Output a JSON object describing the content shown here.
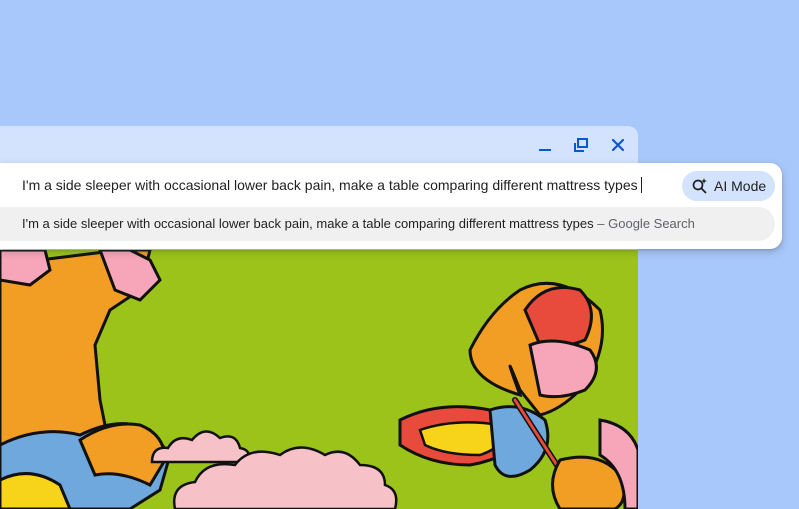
{
  "colors": {
    "background": "#a8c7fa",
    "window_frame": "#d3e3fd",
    "window_controls": "#0b57d0",
    "ai_mode_chip": "#d3e3fd",
    "suggestion_bg": "#f0f0f0",
    "art_green": "#9bc31a"
  },
  "window_controls": {
    "minimize_icon": "minimize-icon",
    "restore_icon": "restore-icon",
    "close_icon": "close-icon"
  },
  "omnibox": {
    "query": "I'm a side sleeper with occasional lower back pain, make a table comparing different mattress types",
    "ai_mode": {
      "icon": "sparkle-search-icon",
      "label": "AI Mode"
    },
    "suggestion": {
      "text": "I'm a side sleeper with occasional lower back pain, make a table comparing different mattress types",
      "separator": "–",
      "source": "Google Search"
    }
  },
  "page_content": {
    "description_icon": "butterfly-illustration"
  }
}
